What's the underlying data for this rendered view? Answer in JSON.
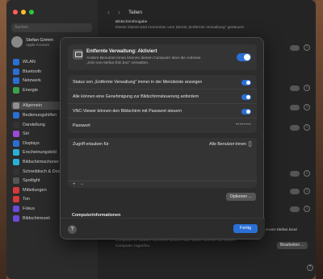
{
  "window": {
    "title": "Teilen"
  },
  "sidebar": {
    "search_placeholder": "Suchen",
    "profile_name": "Stefan Grimm",
    "profile_sub": "Apple Account",
    "items": [
      {
        "label": "WLAN",
        "icon": "wifi-icon",
        "color": "#2a6fd6"
      },
      {
        "label": "Bluetooth",
        "icon": "bluetooth-icon",
        "color": "#2a6fd6"
      },
      {
        "label": "Netzwerk",
        "icon": "network-icon",
        "color": "#2a6fd6"
      },
      {
        "label": "Energie",
        "icon": "battery-icon",
        "color": "#3aa34a"
      },
      {
        "label": "Allgemein",
        "icon": "gear-icon",
        "color": "#8e8e93"
      },
      {
        "label": "Bedienungshilfen",
        "icon": "accessibility-icon",
        "color": "#2a6fd6"
      },
      {
        "label": "Darstellung",
        "icon": "appearance-icon",
        "color": "#333333"
      },
      {
        "label": "Siri",
        "icon": "siri-icon",
        "color": "#9b4ad6"
      },
      {
        "label": "Displays",
        "icon": "display-icon",
        "color": "#2a6fd6"
      },
      {
        "label": "Erscheinungsbild",
        "icon": "wallpaper-icon",
        "color": "#2ab0d6"
      },
      {
        "label": "Bildschirmschoner",
        "icon": "screensaver-icon",
        "color": "#2ab0d6"
      },
      {
        "label": "Schreibtisch & Dock",
        "icon": "dock-icon",
        "color": "#333333"
      },
      {
        "label": "Spotlight",
        "icon": "spotlight-icon",
        "color": "#555555"
      },
      {
        "label": "Mitteilungen",
        "icon": "notifications-icon",
        "color": "#d63a3a"
      },
      {
        "label": "Ton",
        "icon": "sound-icon",
        "color": "#d63a3a"
      },
      {
        "label": "Fokus",
        "icon": "focus-icon",
        "color": "#6a4ad6"
      },
      {
        "label": "Bildschirmzeit",
        "icon": "screentime-icon",
        "color": "#6a4ad6"
      }
    ]
  },
  "background": {
    "top_title": "Bildschirmfreigabe",
    "top_desc": "Dieser Dienst wird momentan vom Dienst „Entfernte Verwaltung\" gesteuert.",
    "hostname_partial": "n-von-Stefan.local",
    "bottom_desc1": "Computer im lokalen Netzwerk können über diese Adresse auf deinen",
    "bottom_desc2": "Computer zugreifen.",
    "bearbeiten_label": "Bearbeiten ...",
    "info_symbol": "i",
    "help_symbol": "?"
  },
  "sheet": {
    "header": {
      "title": "Entfernte Verwaltung: Aktiviert",
      "desc_line1": "Andere Benutzer:innen können deinen Computer über die Adresse",
      "desc_line2": "„mini-von-stefan.fritz.box\" verwalten.",
      "enabled": true
    },
    "options": [
      {
        "label": "Status von „Entfernte Verwaltung\" immer in der Menüleiste anzeigen",
        "enabled": true
      },
      {
        "label": "Alle können eine Genehmigung zur Bildschirmsteuerung anfordern",
        "enabled": true
      },
      {
        "label": "VNC-Viewer können den Bildschirm mit Passwort steuern",
        "enabled": true
      }
    ],
    "password_label": "Passwort",
    "password_mask": "••••••••",
    "access_label": "Zugriff erlauben für",
    "access_value": "Alle Benutzer:innen",
    "add_symbol": "+",
    "remove_symbol": "−",
    "options_button": "Optionen ...",
    "partial_section": "Computerinformationen",
    "help_symbol": "?",
    "done_button": "Fertig"
  },
  "colors": {
    "accent": "#2a6fd6"
  }
}
